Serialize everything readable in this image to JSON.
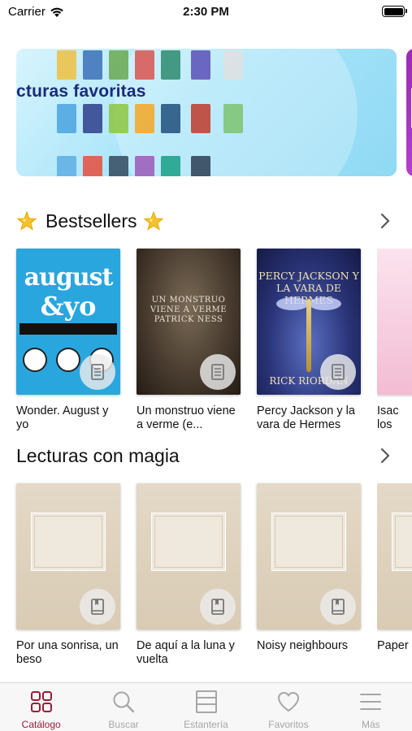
{
  "status_bar": {
    "carrier": "Carrier",
    "time": "2:30 PM"
  },
  "banner": {
    "title": "cturas favoritas"
  },
  "sections": [
    {
      "title": "Bestsellers",
      "books": [
        {
          "title": "Wonder. August y yo",
          "cover_title": "august",
          "cover_title2": "&yo"
        },
        {
          "title": "Un monstruo viene a verme (e...",
          "cover_text": "UN MONSTRUO VIENE A VERME PATRICK NESS"
        },
        {
          "title": "Percy Jackson y la vara de Hermes",
          "cover_text": "PERCY JACKSON Y LA VARA DE HERMES",
          "cover_author": "RICK RIORDAN"
        },
        {
          "title": "Isac los"
        }
      ]
    },
    {
      "title": "Lecturas con magia",
      "books": [
        {
          "title": "Por una sonrisa, un beso"
        },
        {
          "title": "De aquí a la luna y vuelta"
        },
        {
          "title": "Noisy neighbours"
        },
        {
          "title": "Paper"
        }
      ]
    }
  ],
  "tabs": [
    {
      "label": "Catálogo",
      "active": true
    },
    {
      "label": "Buscar"
    },
    {
      "label": "Estantería"
    },
    {
      "label": "Favoritos"
    },
    {
      "label": "Más"
    }
  ],
  "colors": {
    "accent": "#9a1c36",
    "inactive": "#a6a6a6",
    "banner": "#a9e5f9"
  }
}
